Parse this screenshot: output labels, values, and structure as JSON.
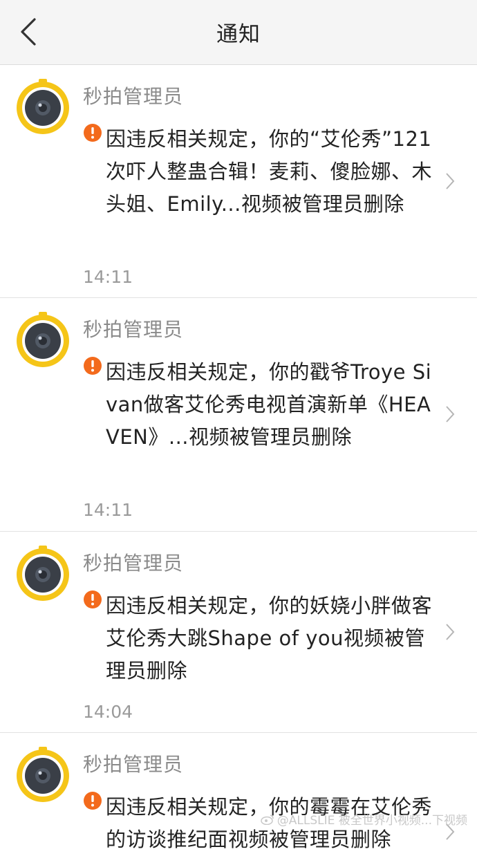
{
  "header": {
    "title": "通知"
  },
  "notifications": [
    {
      "sender": "秒拍管理员",
      "message": "因违反相关规定，你的“艾伦秀”121次吓人整蛊合辑！麦莉、傻脸娜、木头姐、Emily...视频被管理员删除",
      "time": "14:11"
    },
    {
      "sender": "秒拍管理员",
      "message": "因违反相关规定，你的戳爷Troye Sivan做客艾伦秀电视首演新单《HEAVEN》...视频被管理员删除",
      "time": "14:11"
    },
    {
      "sender": "秒拍管理员",
      "message": "因违反相关规定，你的妖娆小胖做客艾伦秀大跳Shape of you视频被管理员删除",
      "time": "14:04"
    },
    {
      "sender": "秒拍管理员",
      "message": "因违反相关规定，你的霉霉在艾伦秀的访谈推纪面视频被管理员删除",
      "time": ""
    }
  ],
  "watermark": "@ALLSLIE 被全世界小视频...下视频",
  "colors": {
    "avatar_ring": "#f5c518",
    "warning": "#f36a1c"
  }
}
